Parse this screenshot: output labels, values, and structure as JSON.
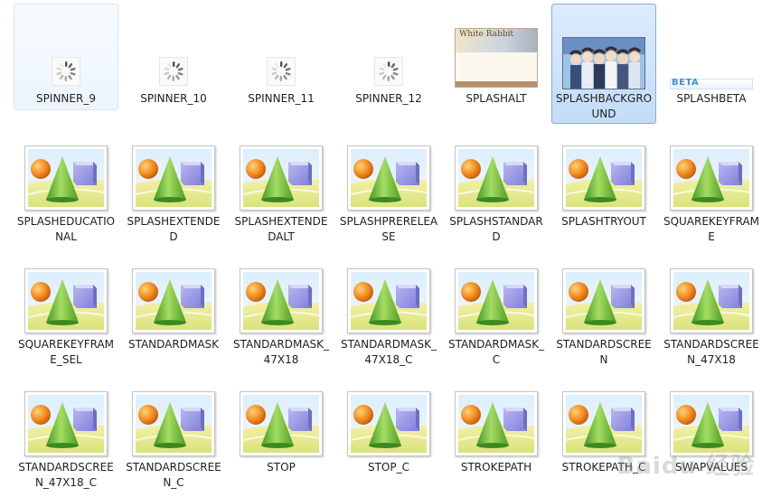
{
  "files": [
    {
      "name": "SPINNER_9",
      "thumb": "spinner",
      "state": "hover"
    },
    {
      "name": "SPINNER_10",
      "thumb": "spinner",
      "state": ""
    },
    {
      "name": "SPINNER_11",
      "thumb": "spinner",
      "state": ""
    },
    {
      "name": "SPINNER_12",
      "thumb": "spinner",
      "state": ""
    },
    {
      "name": "SPLASHALT",
      "thumb": "splash-alt",
      "state": "",
      "thumb_text": "White Rabbit"
    },
    {
      "name": "SPLASHBACKGROUND",
      "thumb": "splash-background",
      "state": "selected"
    },
    {
      "name": "SPLASHBETA",
      "thumb": "splash-beta",
      "state": "",
      "thumb_text": "BETA"
    },
    {
      "name": "SPLASHEDUCATIONAL",
      "thumb": "image",
      "state": ""
    },
    {
      "name": "SPLASHEXTENDED",
      "thumb": "image",
      "state": ""
    },
    {
      "name": "SPLASHEXTENDEDALT",
      "thumb": "image",
      "state": ""
    },
    {
      "name": "SPLASHPRERELEASE",
      "thumb": "image",
      "state": ""
    },
    {
      "name": "SPLASHSTANDARD",
      "thumb": "image",
      "state": ""
    },
    {
      "name": "SPLASHTRYOUT",
      "thumb": "image",
      "state": ""
    },
    {
      "name": "SQUAREKEYFRAME",
      "thumb": "image",
      "state": ""
    },
    {
      "name": "SQUAREKEYFRAME_SEL",
      "thumb": "image",
      "state": ""
    },
    {
      "name": "STANDARDMASK",
      "thumb": "image",
      "state": ""
    },
    {
      "name": "STANDARDMASK_47X18",
      "thumb": "image",
      "state": ""
    },
    {
      "name": "STANDARDMASK_47X18_C",
      "thumb": "image",
      "state": ""
    },
    {
      "name": "STANDARDMASK_C",
      "thumb": "image",
      "state": ""
    },
    {
      "name": "STANDARDSCREEN",
      "thumb": "image",
      "state": ""
    },
    {
      "name": "STANDARDSCREEN_47X18",
      "thumb": "image",
      "state": ""
    },
    {
      "name": "STANDARDSCREEN_47X18_C",
      "thumb": "image",
      "state": ""
    },
    {
      "name": "STANDARDSCREEN_C",
      "thumb": "image",
      "state": ""
    },
    {
      "name": "STOP",
      "thumb": "image",
      "state": ""
    },
    {
      "name": "STOP_C",
      "thumb": "image",
      "state": ""
    },
    {
      "name": "STROKEPATH",
      "thumb": "image",
      "state": ""
    },
    {
      "name": "STROKEPATH_C",
      "thumb": "image",
      "state": ""
    },
    {
      "name": "SWAPVALUES",
      "thumb": "image",
      "state": ""
    }
  ],
  "watermark": "Baidu 经验"
}
